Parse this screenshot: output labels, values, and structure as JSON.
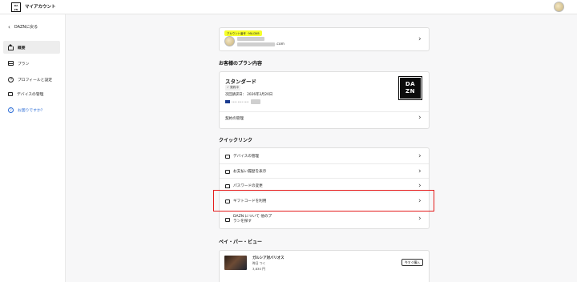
{
  "header": {
    "logo_text": "DA ZN",
    "title": "マイアカウント"
  },
  "sidebar": {
    "back_label": "DAZNに戻る",
    "items": [
      {
        "label": "概要"
      },
      {
        "label": "プラン"
      },
      {
        "label": "プロフィールと設定"
      },
      {
        "label": "デバイスの管理"
      },
      {
        "label": "お困りですか？"
      }
    ]
  },
  "account_card": {
    "badge": "アカウント番号 · MA-DN5",
    "email_suffix": ".com"
  },
  "plan_section": {
    "heading": "お客様のプラン内容",
    "plan_name": "スタンダード",
    "status": "✓ 契約中",
    "billing": "次回請求日： 2026年3月20日",
    "payment_text": "•••• •••• ••••",
    "manage_label": "契約の管理",
    "dazn_logo": "DA\nZN"
  },
  "quick_links": {
    "heading": "クイックリンク",
    "items": [
      {
        "label": "デバイスの管理"
      },
      {
        "label": "お支払い履歴を表示"
      },
      {
        "label": "パスワードの変更"
      },
      {
        "label": "ギフトコードを利用"
      },
      {
        "label": "DAZN について 他のプランを探す"
      }
    ]
  },
  "ppv_section": {
    "heading": "ペイ・パー・ビュー",
    "movie_title": "ガルシア対バリオス",
    "movie_date": "昨日 つく",
    "movie_price": "3,830 円",
    "buy_label": "今すぐ購入"
  },
  "colors": {
    "highlight": "#e51b1b",
    "badge": "#f6ff2a",
    "link": "#2b6cd6"
  }
}
